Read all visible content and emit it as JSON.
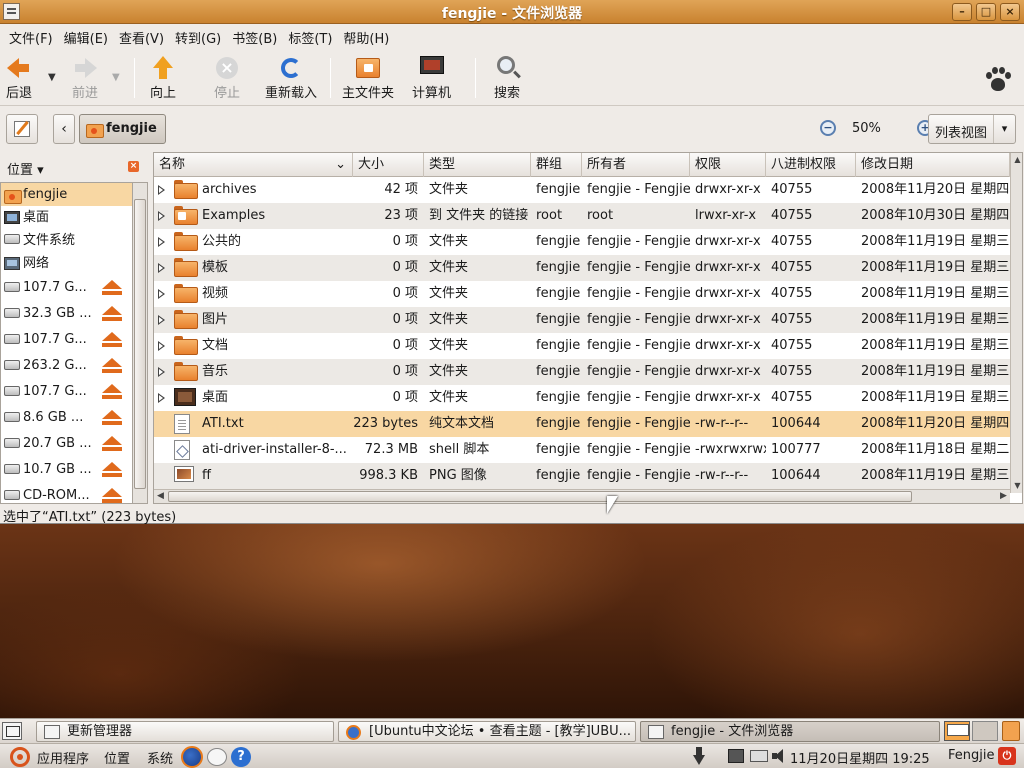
{
  "window": {
    "title": "fengjie - 文件浏览器",
    "controls": [
      "–",
      "□",
      "×"
    ]
  },
  "menubar": [
    "文件(F)",
    "编辑(E)",
    "查看(V)",
    "转到(G)",
    "书签(B)",
    "标签(T)",
    "帮助(H)"
  ],
  "toolbar": {
    "back": "后退",
    "forward": "前进",
    "up": "向上",
    "stop": "停止",
    "reload": "重新载入",
    "home": "主文件夹",
    "computer": "计算机",
    "search": "搜索"
  },
  "location": {
    "back_arrow": "‹",
    "crumb": "fengjie",
    "zoom": "50%",
    "view": "列表视图",
    "zoom_out_glyph": "−",
    "zoom_in_glyph": "+",
    "view_chevron": "▾"
  },
  "sidebar": {
    "header": "位置",
    "close_glyph": "×",
    "places": [
      {
        "label": "fengjie",
        "icon": "home-icon",
        "selected": true
      },
      {
        "label": "桌面",
        "icon": "desktop-icon"
      },
      {
        "label": "文件系统",
        "icon": "drive-icon"
      },
      {
        "label": "网络",
        "icon": "network-icon"
      }
    ],
    "volumes": [
      {
        "label": "107.7 G..."
      },
      {
        "label": "32.3 GB ..."
      },
      {
        "label": "107.7 G..."
      },
      {
        "label": "263.2 G..."
      },
      {
        "label": "107.7 G..."
      },
      {
        "label": "8.6 GB ..."
      },
      {
        "label": "20.7 GB ..."
      },
      {
        "label": "10.7 GB ..."
      },
      {
        "label": "CD-ROM..."
      }
    ]
  },
  "table": {
    "columns": [
      "名称",
      "大小",
      "类型",
      "群组",
      "所有者",
      "权限",
      "八进制权限",
      "修改日期"
    ],
    "rows": [
      {
        "name": "archives",
        "size": "42 项",
        "type": "文件夹",
        "group": "fengjie",
        "owner": "fengjie - Fengjie",
        "perm": "drwxr-xr-x",
        "octal": "40755",
        "date": "2008年11月20日 星期四",
        "icon": "folder",
        "expandable": true
      },
      {
        "name": "Examples",
        "size": "23 项",
        "type": "到 文件夹 的链接",
        "group": "root",
        "owner": "root",
        "perm": "lrwxr-xr-x",
        "octal": "40755",
        "date": "2008年10月30日 星期四",
        "icon": "folder-link",
        "expandable": true
      },
      {
        "name": "公共的",
        "size": "0 项",
        "type": "文件夹",
        "group": "fengjie",
        "owner": "fengjie - Fengjie",
        "perm": "drwxr-xr-x",
        "octal": "40755",
        "date": "2008年11月19日 星期三",
        "icon": "folder",
        "expandable": true
      },
      {
        "name": "模板",
        "size": "0 项",
        "type": "文件夹",
        "group": "fengjie",
        "owner": "fengjie - Fengjie",
        "perm": "drwxr-xr-x",
        "octal": "40755",
        "date": "2008年11月19日 星期三",
        "icon": "folder",
        "expandable": true
      },
      {
        "name": "视频",
        "size": "0 项",
        "type": "文件夹",
        "group": "fengjie",
        "owner": "fengjie - Fengjie",
        "perm": "drwxr-xr-x",
        "octal": "40755",
        "date": "2008年11月19日 星期三",
        "icon": "folder",
        "expandable": true
      },
      {
        "name": "图片",
        "size": "0 项",
        "type": "文件夹",
        "group": "fengjie",
        "owner": "fengjie - Fengjie",
        "perm": "drwxr-xr-x",
        "octal": "40755",
        "date": "2008年11月19日 星期三",
        "icon": "folder",
        "expandable": true
      },
      {
        "name": "文档",
        "size": "0 项",
        "type": "文件夹",
        "group": "fengjie",
        "owner": "fengjie - Fengjie",
        "perm": "drwxr-xr-x",
        "octal": "40755",
        "date": "2008年11月19日 星期三",
        "icon": "folder",
        "expandable": true
      },
      {
        "name": "音乐",
        "size": "0 项",
        "type": "文件夹",
        "group": "fengjie",
        "owner": "fengjie - Fengjie",
        "perm": "drwxr-xr-x",
        "octal": "40755",
        "date": "2008年11月19日 星期三",
        "icon": "folder",
        "expandable": true
      },
      {
        "name": "桌面",
        "size": "0 项",
        "type": "文件夹",
        "group": "fengjie",
        "owner": "fengjie - Fengjie",
        "perm": "drwxr-xr-x",
        "octal": "40755",
        "date": "2008年11月19日 星期三",
        "icon": "desktop-folder",
        "expandable": true
      },
      {
        "name": "ATI.txt",
        "size": "223 bytes",
        "type": "纯文本文档",
        "group": "fengjie",
        "owner": "fengjie - Fengjie",
        "perm": "-rw-r--r--",
        "octal": "100644",
        "date": "2008年11月20日 星期四",
        "icon": "doc",
        "expandable": false,
        "selected": true
      },
      {
        "name": "ati-driver-installer-8-...",
        "size": "72.3 MB",
        "type": "shell 脚本",
        "group": "fengjie",
        "owner": "fengjie - Fengjie",
        "perm": "-rwxrwxrwx",
        "octal": "100777",
        "date": "2008年11月18日 星期二",
        "icon": "script",
        "expandable": false
      },
      {
        "name": "ff",
        "size": "998.3 KB",
        "type": "PNG 图像",
        "group": "fengjie",
        "owner": "fengjie - Fengjie",
        "perm": "-rw-r--r--",
        "octal": "100644",
        "date": "2008年11月19日 星期三",
        "icon": "image",
        "expandable": false
      }
    ]
  },
  "statusbar": "选中了“ATI.txt” (223 bytes)",
  "taskbar": {
    "tasks": [
      {
        "label": "更新管理器",
        "icon": "update-icon"
      },
      {
        "label": "[Ubuntu中文论坛 • 查看主题 - [教学]UBU...",
        "icon": "firefox-icon"
      },
      {
        "label": "fengjie - 文件浏览器",
        "icon": "file-browser-icon",
        "active": true
      }
    ]
  },
  "panel": {
    "applications": "应用程序",
    "places": "位置",
    "system": "系统",
    "help_glyph": "?",
    "clock": "11月20日星期四 19:25",
    "user": "Fengjie",
    "power_glyph": "⏻"
  },
  "colors": {
    "titlebar": "#d08a38",
    "selection": "#f8d7a3",
    "accent": "#e57a1e"
  }
}
